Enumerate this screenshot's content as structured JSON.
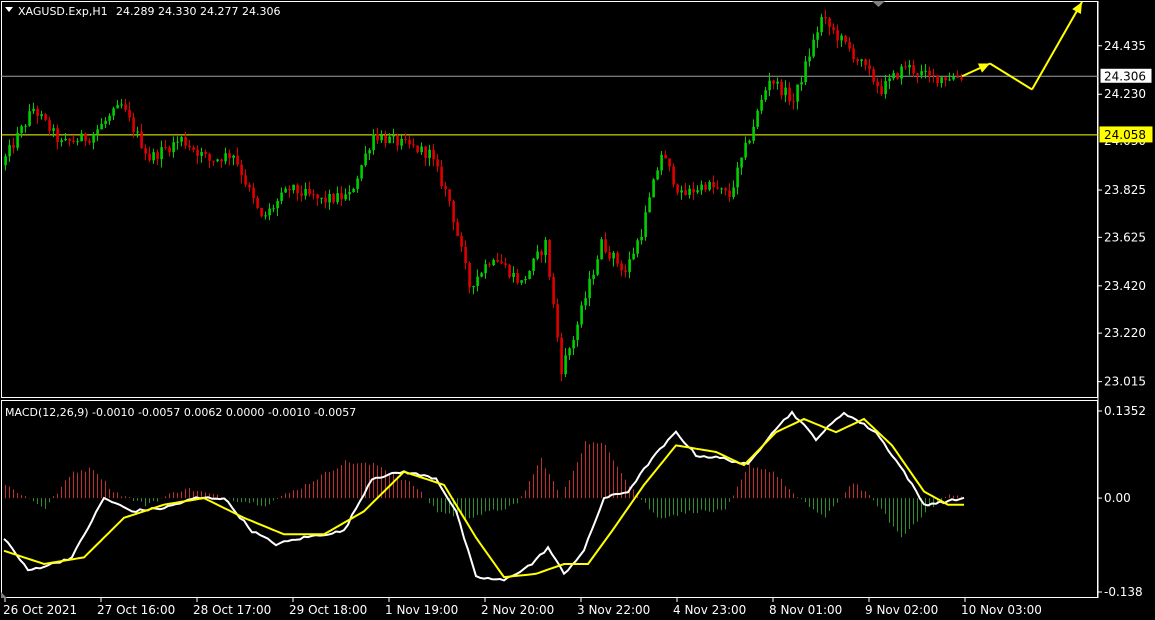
{
  "header": {
    "symbol": "XAGUSD.Exp,H1",
    "ohlc": "24.289 24.330 24.277 24.306"
  },
  "colors": {
    "background": "#000000",
    "frame": "#ffffff",
    "bull": "#00d000",
    "bear": "#e00000",
    "level_line": "#ffff00",
    "bid_line": "#a0a0a0",
    "macd_line": "#ffffff",
    "signal_line": "#ffff00",
    "hist_pos": "#c03030",
    "hist_neg": "#2f8f2f",
    "forecast": "#ffff00"
  },
  "icons": {
    "dropdown": "triangle-down-icon",
    "scroll_marker": "triangle-marker-icon",
    "forecast_arrow": "arrow-icon"
  },
  "chart_data": [
    {
      "type": "candlestick",
      "symbol": "XAGUSD.Exp",
      "timeframe": "H1",
      "ylim": [
        22.95,
        24.62
      ],
      "yticks": [
        "24.435",
        "24.230",
        "23.825",
        "23.625",
        "23.420",
        "23.220",
        "23.015"
      ],
      "ytick_values": [
        24.435,
        24.23,
        23.825,
        23.625,
        23.42,
        23.22,
        23.015
      ],
      "current_price": {
        "label": "24.306",
        "value": 24.306
      },
      "level_line": {
        "label": "24.058",
        "value": 24.058
      },
      "partial_tick": "24.030",
      "xticks": [
        "26 Oct 2021",
        "27 Oct 16:00",
        "28 Oct 17:00",
        "29 Oct 18:00",
        "1 Nov 19:00",
        "2 Nov 20:00",
        "3 Nov 22:00",
        "4 Nov 23:00",
        "8 Nov 01:00",
        "9 Nov 02:00",
        "10 Nov 03:00"
      ],
      "bars_shown": 240,
      "close_anchors": [
        [
          0,
          23.93
        ],
        [
          8,
          24.17
        ],
        [
          15,
          24.02
        ],
        [
          22,
          24.05
        ],
        [
          30,
          24.18
        ],
        [
          37,
          23.96
        ],
        [
          45,
          24.04
        ],
        [
          52,
          23.95
        ],
        [
          58,
          23.98
        ],
        [
          65,
          23.7
        ],
        [
          72,
          23.83
        ],
        [
          80,
          23.78
        ],
        [
          87,
          23.8
        ],
        [
          93,
          24.06
        ],
        [
          100,
          24.02
        ],
        [
          107,
          23.98
        ],
        [
          112,
          23.78
        ],
        [
          117,
          23.42
        ],
        [
          123,
          23.55
        ],
        [
          130,
          23.43
        ],
        [
          136,
          23.6
        ],
        [
          140,
          23.07
        ],
        [
          143,
          23.2
        ],
        [
          150,
          23.6
        ],
        [
          156,
          23.48
        ],
        [
          160,
          23.65
        ],
        [
          165,
          23.98
        ],
        [
          170,
          23.8
        ],
        [
          176,
          23.85
        ],
        [
          182,
          23.8
        ],
        [
          188,
          24.1
        ],
        [
          192,
          24.3
        ],
        [
          198,
          24.2
        ],
        [
          205,
          24.55
        ],
        [
          212,
          24.42
        ],
        [
          220,
          24.25
        ],
        [
          226,
          24.35
        ],
        [
          232,
          24.3
        ],
        [
          240,
          24.306
        ]
      ],
      "forecast_path": [
        {
          "x": "10 Nov 03:00",
          "y": 24.306
        },
        {
          "x": "+4h",
          "y": 24.36
        },
        {
          "x": "+14h",
          "y": 24.25
        },
        {
          "x": "+26h",
          "y": 24.62
        }
      ]
    },
    {
      "type": "line",
      "indicator": "MACD(12,26,9)",
      "values_text": "-0.0010 -0.0057 0.0062 0.0000 -0.0010 -0.0057",
      "ylim": [
        -0.138,
        0.1352
      ],
      "yticks": [
        "0.1352",
        "0.00",
        "-0.138"
      ],
      "ytick_values": [
        0.1352,
        0.0,
        -0.138
      ],
      "series": [
        {
          "name": "MACD",
          "anchors": [
            [
              0,
              -0.06
            ],
            [
              6,
              -0.11
            ],
            [
              12,
              -0.1
            ],
            [
              17,
              -0.09
            ],
            [
              25,
              0.0
            ],
            [
              32,
              -0.02
            ],
            [
              40,
              -0.015
            ],
            [
              48,
              0.0
            ],
            [
              55,
              0.0
            ],
            [
              62,
              -0.05
            ],
            [
              68,
              -0.07
            ],
            [
              75,
              -0.06
            ],
            [
              85,
              -0.05
            ],
            [
              92,
              0.03
            ],
            [
              100,
              0.04
            ],
            [
              108,
              0.03
            ],
            [
              113,
              -0.02
            ],
            [
              118,
              -0.12
            ],
            [
              125,
              -0.125
            ],
            [
              132,
              -0.1
            ],
            [
              136,
              -0.075
            ],
            [
              140,
              -0.115
            ],
            [
              145,
              -0.08
            ],
            [
              150,
              0.0
            ],
            [
              156,
              0.01
            ],
            [
              162,
              0.06
            ],
            [
              168,
              0.1
            ],
            [
              173,
              0.065
            ],
            [
              180,
              0.06
            ],
            [
              186,
              0.05
            ],
            [
              192,
              0.1
            ],
            [
              197,
              0.13
            ],
            [
              203,
              0.09
            ],
            [
              210,
              0.13
            ],
            [
              218,
              0.1
            ],
            [
              225,
              0.04
            ],
            [
              230,
              -0.01
            ],
            [
              236,
              -0.005
            ],
            [
              240,
              0.0
            ]
          ]
        },
        {
          "name": "Signal",
          "anchors": [
            [
              0,
              -0.08
            ],
            [
              10,
              -0.1
            ],
            [
              20,
              -0.09
            ],
            [
              30,
              -0.03
            ],
            [
              40,
              -0.01
            ],
            [
              50,
              0.0
            ],
            [
              60,
              -0.03
            ],
            [
              70,
              -0.055
            ],
            [
              80,
              -0.055
            ],
            [
              90,
              -0.02
            ],
            [
              100,
              0.04
            ],
            [
              110,
              0.02
            ],
            [
              118,
              -0.06
            ],
            [
              125,
              -0.12
            ],
            [
              133,
              -0.115
            ],
            [
              140,
              -0.1
            ],
            [
              146,
              -0.1
            ],
            [
              152,
              -0.05
            ],
            [
              160,
              0.02
            ],
            [
              168,
              0.08
            ],
            [
              178,
              0.07
            ],
            [
              185,
              0.05
            ],
            [
              193,
              0.1
            ],
            [
              200,
              0.12
            ],
            [
              208,
              0.1
            ],
            [
              215,
              0.12
            ],
            [
              222,
              0.08
            ],
            [
              230,
              0.01
            ],
            [
              236,
              -0.01
            ],
            [
              240,
              -0.01
            ]
          ]
        }
      ],
      "histogram_anchors": [
        [
          0,
          0.02
        ],
        [
          10,
          -0.015
        ],
        [
          17,
          0.04
        ],
        [
          22,
          0.045
        ],
        [
          27,
          0.01
        ],
        [
          35,
          -0.01
        ],
        [
          45,
          0.015
        ],
        [
          55,
          0.0
        ],
        [
          65,
          -0.01
        ],
        [
          75,
          0.02
        ],
        [
          85,
          0.055
        ],
        [
          93,
          0.05
        ],
        [
          102,
          0.02
        ],
        [
          108,
          -0.02
        ],
        [
          115,
          -0.03
        ],
        [
          122,
          -0.02
        ],
        [
          128,
          -0.01
        ],
        [
          134,
          0.06
        ],
        [
          139,
          0.0
        ],
        [
          145,
          0.085
        ],
        [
          150,
          0.08
        ],
        [
          156,
          0.02
        ],
        [
          163,
          -0.03
        ],
        [
          172,
          -0.02
        ],
        [
          180,
          -0.02
        ],
        [
          186,
          0.05
        ],
        [
          192,
          0.04
        ],
        [
          198,
          0.0
        ],
        [
          205,
          -0.03
        ],
        [
          212,
          0.025
        ],
        [
          218,
          -0.01
        ],
        [
          224,
          -0.06
        ],
        [
          230,
          -0.02
        ],
        [
          236,
          0.005
        ],
        [
          240,
          0.0
        ]
      ]
    }
  ]
}
